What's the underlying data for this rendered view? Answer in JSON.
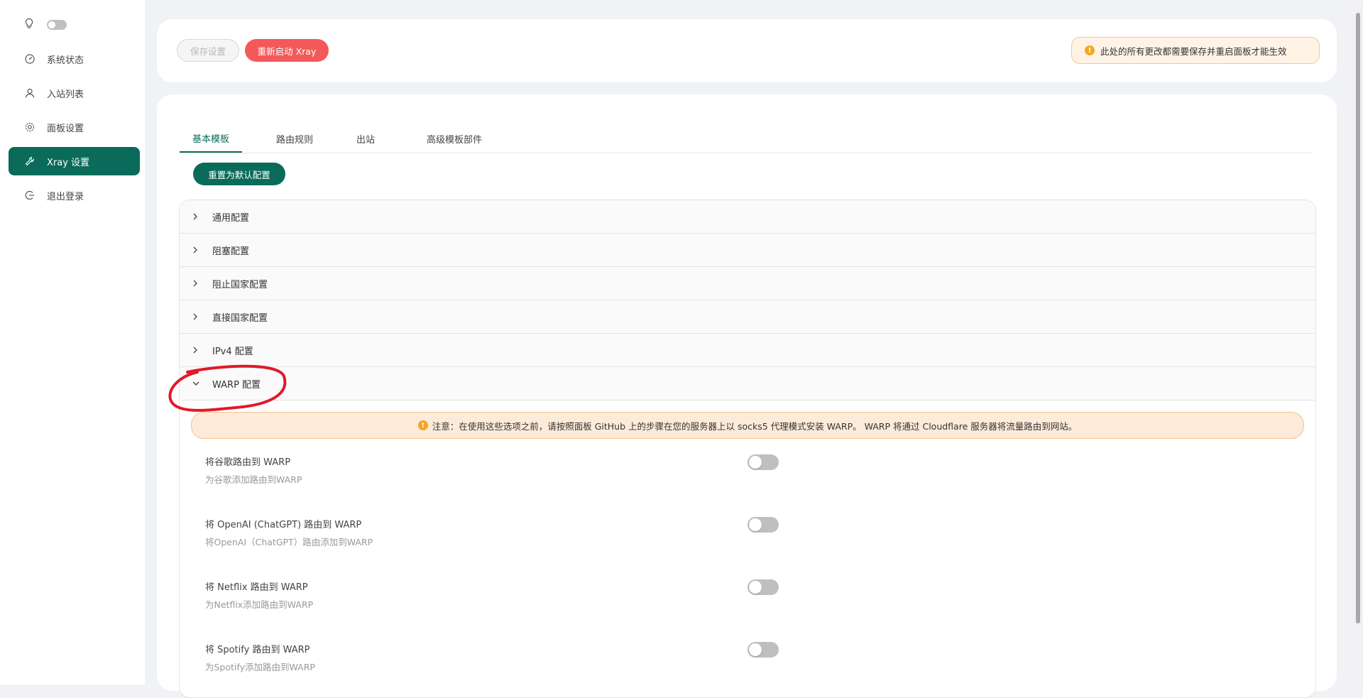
{
  "sidebar": {
    "items": [
      {
        "label": "系统状态",
        "icon": "dashboard-icon"
      },
      {
        "label": "入站列表",
        "icon": "user-icon"
      },
      {
        "label": "面板设置",
        "icon": "gear-icon"
      },
      {
        "label": "Xray 设置",
        "icon": "tool-icon",
        "active": true
      },
      {
        "label": "退出登录",
        "icon": "logout-icon"
      }
    ]
  },
  "toolbar": {
    "save_label": "保存设置",
    "restart_label": "重新启动 Xray",
    "notice": "此处的所有更改都需要保存并重启面板才能生效"
  },
  "tabs": [
    "基本模板",
    "路由规则",
    "出站",
    "高级模板部件"
  ],
  "reset_label": "重置为默认配置",
  "panels": [
    "通用配置",
    "阻塞配置",
    "阻止国家配置",
    "直接国家配置",
    "IPv4 配置",
    "WARP 配置"
  ],
  "warp": {
    "notice": "注意：在使用这些选项之前，请按照面板 GitHub 上的步骤在您的服务器上以 socks5 代理模式安装 WARP。 WARP 将通过 Cloudflare 服务器将流量路由到网站。",
    "settings": [
      {
        "title": "将谷歌路由到 WARP",
        "desc": "为谷歌添加路由到WARP",
        "enabled": false
      },
      {
        "title": "将 OpenAI (ChatGPT) 路由到 WARP",
        "desc": "将OpenAI（ChatGPT）路由添加到WARP",
        "enabled": false
      },
      {
        "title": "将 Netflix 路由到 WARP",
        "desc": "为Netflix添加路由到WARP",
        "enabled": false
      },
      {
        "title": "将 Spotify 路由到 WARP",
        "desc": "为Spotify添加路由到WARP",
        "enabled": false
      }
    ]
  },
  "colors": {
    "primary": "#0b6b5a",
    "danger": "#f25a5a",
    "warning": "#f5a623",
    "annotation": "#e0192a"
  }
}
